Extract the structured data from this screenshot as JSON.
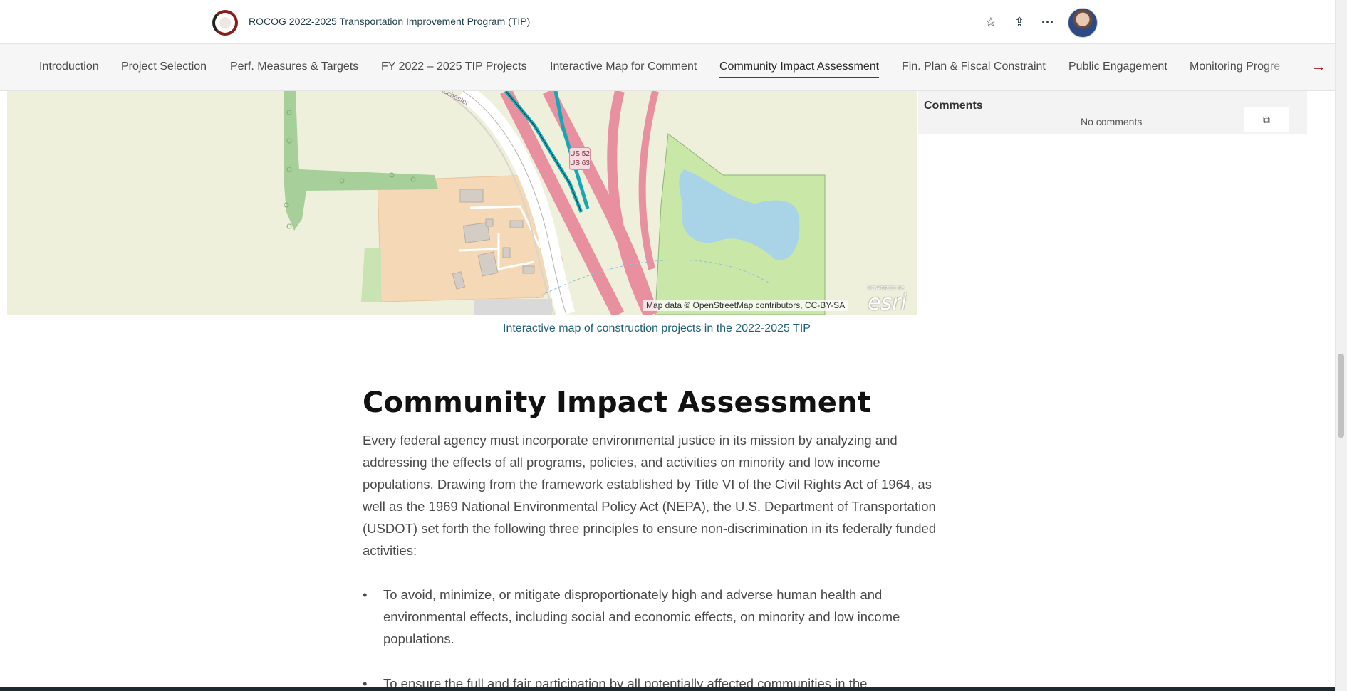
{
  "header": {
    "title": "ROCOG 2022-2025 Transportation Improvement Program (TIP)",
    "logo_icon": "rocog-logo",
    "icons": [
      "star-icon",
      "share-icon",
      "more-icon"
    ],
    "favorite_glyph": "☆",
    "share_glyph": "⇪",
    "more_glyph": "···"
  },
  "nav": {
    "items": [
      {
        "label": "Introduction"
      },
      {
        "label": "Project Selection"
      },
      {
        "label": "Perf. Measures & Targets"
      },
      {
        "label": "FY 2022 – 2025 TIP Projects"
      },
      {
        "label": "Interactive Map for Comment"
      },
      {
        "label": "Community Impact Assessment",
        "active": true
      },
      {
        "label": "Fin. Plan & Fiscal Constraint"
      },
      {
        "label": "Public Engagement"
      },
      {
        "label": "Monitoring Progre"
      }
    ],
    "next_glyph": "→",
    "accent_color": "#9a1c1c"
  },
  "map": {
    "road_label": "Rochester",
    "shield_line1": "US 52",
    "shield_line2": "US 63",
    "attribution": "Map data © OpenStreetMap contributors, CC-BY-SA",
    "powered_by": "POWERED BY",
    "esri": "esri",
    "caption": "Interactive map of construction projects in the 2022-2025 TIP"
  },
  "comments": {
    "title": "Comments",
    "empty_text": "No comments",
    "open_glyph": "⧉"
  },
  "article": {
    "heading": "Community Impact Assessment",
    "paragraph": "Every federal agency must incorporate environmental justice in its mission by analyzing and addressing the effects of all programs, policies, and activities on minority and low income populations. Drawing from the framework established by Title VI of the Civil Rights Act of 1964, as well as the 1969 National Environmental Policy Act (NEPA), the U.S. Department of Transportation (USDOT) set forth the following three principles to ensure non-discrimination in its federally funded activities:",
    "bullets": [
      "To avoid, minimize, or mitigate disproportionately high and adverse human health and environmental effects, including social and economic effects, on minority and low income populations.",
      "To ensure the full and fair participation by all potentially affected communities in the"
    ]
  }
}
